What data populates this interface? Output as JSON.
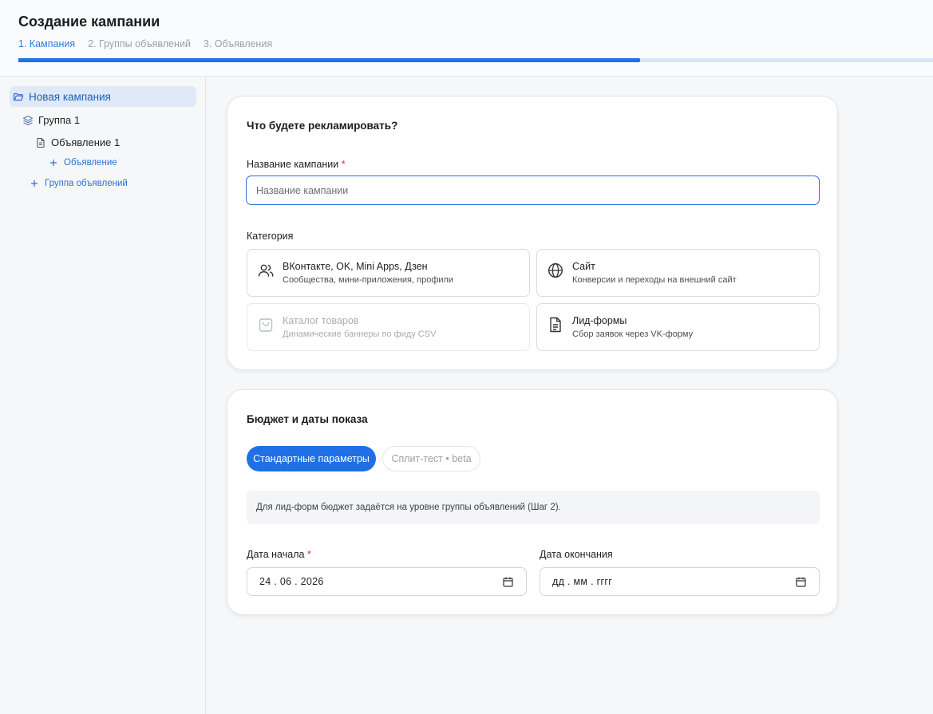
{
  "header": {
    "title": "Создание кампании",
    "steps": [
      "1. Кампания",
      "2. Группы объявлений",
      "3. Объявления"
    ],
    "progress": 0.68
  },
  "sidebar": {
    "campaign": "Новая кампания",
    "group": "Группа 1",
    "ad": "Объявление 1",
    "add_ad": "Объявление",
    "add_group": "Группа объявлений"
  },
  "card1": {
    "title": "Что будете рекламировать?",
    "name_label": "Название кампании",
    "required_mark": "*",
    "name_placeholder": "Название кампании",
    "category_label": "Категория",
    "categories": [
      {
        "title": "ВКонтакте, OK, Mini Apps, Дзен",
        "subtitle": "Сообщества, мини-приложения, профили",
        "icon": "users-icon",
        "disabled": false
      },
      {
        "title": "Сайт",
        "subtitle": "Конверсии и переходы на внешний сайт",
        "icon": "globe-icon",
        "disabled": false
      },
      {
        "title": "Каталог товаров",
        "subtitle": "Динамические баннеры по фиду CSV",
        "icon": "bag-icon",
        "disabled": true
      },
      {
        "title": "Лид-формы",
        "subtitle": "Сбор заявок через VK-форму",
        "icon": "document-icon",
        "disabled": false
      }
    ]
  },
  "card2": {
    "title": "Бюджет и даты показа",
    "tab_standard": "Стандартные параметры",
    "tab_split": "Сплит-тест • beta",
    "note": "Для лид-форм бюджет задаётся на уровне группы объявлений (Шаг 2).",
    "start_label": "Дата начала",
    "required_mark": "*",
    "start_value": "24 . 06 . 2026",
    "end_label": "Дата окончания",
    "end_value": "дд . мм . гггг"
  },
  "colors": {
    "accent": "#1f6fe6",
    "required": "#e0333d"
  }
}
